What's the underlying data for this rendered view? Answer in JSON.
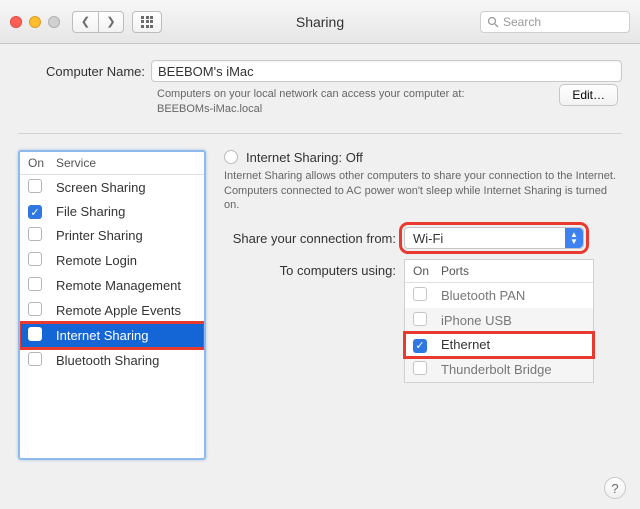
{
  "window": {
    "title": "Sharing"
  },
  "search": {
    "placeholder": "Search"
  },
  "computer_name": {
    "label": "Computer Name:",
    "value": "BEEBOM's iMac",
    "subtext_line1": "Computers on your local network can access your computer at:",
    "subtext_line2": "BEEBOMs-iMac.local",
    "edit_label": "Edit…"
  },
  "services": {
    "on_header": "On",
    "service_header": "Service",
    "items": [
      {
        "label": "Screen Sharing",
        "checked": false,
        "selected": false
      },
      {
        "label": "File Sharing",
        "checked": true,
        "selected": false
      },
      {
        "label": "Printer Sharing",
        "checked": false,
        "selected": false
      },
      {
        "label": "Remote Login",
        "checked": false,
        "selected": false
      },
      {
        "label": "Remote Management",
        "checked": false,
        "selected": false
      },
      {
        "label": "Remote Apple Events",
        "checked": false,
        "selected": false
      },
      {
        "label": "Internet Sharing",
        "checked": false,
        "selected": true
      },
      {
        "label": "Bluetooth Sharing",
        "checked": false,
        "selected": false
      }
    ]
  },
  "detail": {
    "status_title": "Internet Sharing: Off",
    "description": "Internet Sharing allows other computers to share your connection to the Internet. Computers connected to AC power won't sleep while Internet Sharing is turned on.",
    "share_from_label": "Share your connection from:",
    "share_from_value": "Wi-Fi",
    "ports_label": "To computers using:",
    "ports": {
      "on_header": "On",
      "ports_header": "Ports",
      "items": [
        {
          "label": "Bluetooth PAN",
          "checked": false
        },
        {
          "label": "iPhone USB",
          "checked": false
        },
        {
          "label": "Ethernet",
          "checked": true
        },
        {
          "label": "Thunderbolt Bridge",
          "checked": false
        }
      ]
    }
  },
  "help_label": "?"
}
